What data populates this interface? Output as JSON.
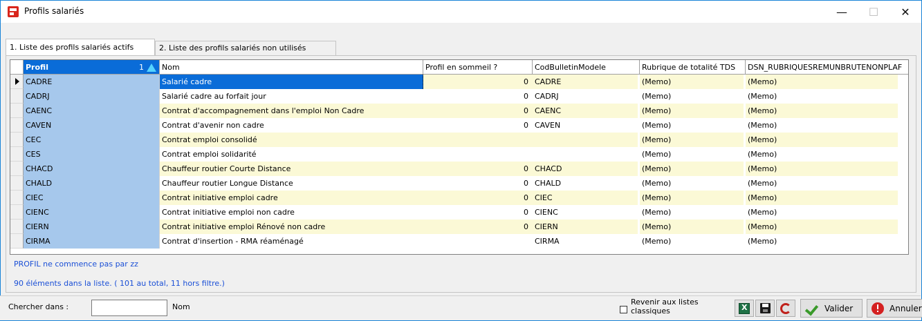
{
  "window": {
    "title": "Profils salariés",
    "minimize_glyph": "—",
    "maximize_glyph": "☐",
    "close_glyph": "✕"
  },
  "tabs": [
    {
      "label": "1. Liste des profils salariés actifs",
      "active": true
    },
    {
      "label": "2. Liste des profils salariés non utilisés",
      "active": false
    }
  ],
  "grid": {
    "columns": {
      "profil": "Profil",
      "profil_sort_index": "1",
      "nom": "Nom",
      "sommeil": "Profil en sommeil ?",
      "codbul": "CodBulletinModele",
      "rubrique": "Rubrique de totalité TDS",
      "dsn": "DSN_RUBRIQUESREMUNBRUTENONPLAF"
    },
    "rows": [
      {
        "profil": "CADRE",
        "nom": "Salarié cadre",
        "sommeil": "0",
        "codbul": "CADRE",
        "rubrique": "(Memo)",
        "dsn": "(Memo)"
      },
      {
        "profil": "CADRJ",
        "nom": "Salarié cadre au forfait jour",
        "sommeil": "0",
        "codbul": "CADRJ",
        "rubrique": "(Memo)",
        "dsn": "(Memo)"
      },
      {
        "profil": "CAENC",
        "nom": "Contrat d'accompagnement dans l'emploi Non Cadre",
        "sommeil": "0",
        "codbul": "CAENC",
        "rubrique": "(Memo)",
        "dsn": "(Memo)"
      },
      {
        "profil": "CAVEN",
        "nom": "Contrat d'avenir non cadre",
        "sommeil": "0",
        "codbul": "CAVEN",
        "rubrique": "(Memo)",
        "dsn": "(Memo)"
      },
      {
        "profil": "CEC",
        "nom": "Contrat emploi consolidé",
        "sommeil": "",
        "codbul": "",
        "rubrique": "(Memo)",
        "dsn": "(Memo)"
      },
      {
        "profil": "CES",
        "nom": "Contrat emploi solidarité",
        "sommeil": "",
        "codbul": "",
        "rubrique": "(Memo)",
        "dsn": "(Memo)"
      },
      {
        "profil": "CHACD",
        "nom": "Chauffeur routier Courte Distance",
        "sommeil": "0",
        "codbul": "CHACD",
        "rubrique": "(Memo)",
        "dsn": "(Memo)"
      },
      {
        "profil": "CHALD",
        "nom": "Chauffeur routier Longue Distance",
        "sommeil": "0",
        "codbul": "CHALD",
        "rubrique": "(Memo)",
        "dsn": "(Memo)"
      },
      {
        "profil": "CIEC",
        "nom": "Contrat initiative emploi cadre",
        "sommeil": "0",
        "codbul": "CIEC",
        "rubrique": "(Memo)",
        "dsn": "(Memo)"
      },
      {
        "profil": "CIENC",
        "nom": "Contrat initiative emploi non cadre",
        "sommeil": "0",
        "codbul": "CIENC",
        "rubrique": "(Memo)",
        "dsn": "(Memo)"
      },
      {
        "profil": "CIERN",
        "nom": "Contrat initiative emploi Rénové non cadre",
        "sommeil": "0",
        "codbul": "CIERN",
        "rubrique": "(Memo)",
        "dsn": "(Memo)"
      },
      {
        "profil": "CIRMA",
        "nom": "Contrat d'insertion - RMA réaménagé",
        "sommeil": "",
        "codbul": "CIRMA",
        "rubrique": "(Memo)",
        "dsn": "(Memo)"
      }
    ],
    "selected_row": 0
  },
  "status": {
    "filter": "PROFIL ne commence pas par zz",
    "count": "90 éléments dans la liste. ( 101 au total, 11 hors filtre.)"
  },
  "bottom": {
    "search_label": "Chercher dans :",
    "search_value": "",
    "search_field": "Nom",
    "checkbox_label": "Revenir aux listes classiques",
    "valider": "Valider",
    "annuler": "Annuler"
  },
  "colors": {
    "accent": "#0a6cd8",
    "profil_column": "#a6c8ec",
    "odd_row": "#fbf9d6",
    "status_text": "#1a4fd6"
  }
}
